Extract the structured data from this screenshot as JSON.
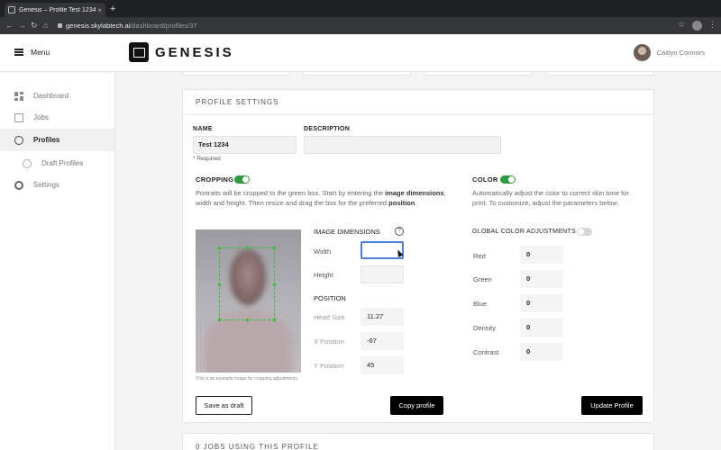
{
  "browser": {
    "tab_title": "Genesis – Profile Test 1234",
    "tab_close": "×",
    "new_tab": "+",
    "url_host": "genesis.skylabtech.ai",
    "url_path": "/dashboard/profiles/37"
  },
  "header": {
    "menu_label": "Menu",
    "brand": "GENESIS",
    "user_name": "Caitlyn Connors"
  },
  "sidebar": {
    "items": [
      {
        "label": "Dashboard",
        "icon": "dashboard-icon"
      },
      {
        "label": "Jobs",
        "icon": "jobs-icon"
      },
      {
        "label": "Profiles",
        "icon": "profiles-icon",
        "active": true
      },
      {
        "label": "Draft Profiles",
        "icon": "draft-profiles-icon"
      },
      {
        "label": "Settings",
        "icon": "gear-icon"
      }
    ]
  },
  "profile_settings": {
    "title": "PROFILE SETTINGS",
    "name_label": "NAME",
    "name_value": "Test 1234",
    "required_note": "* Required",
    "description_label": "DESCRIPTION",
    "description_value": ""
  },
  "cropping": {
    "title": "CROPPING",
    "enabled": true,
    "desc_1": "Portraits will be cropped to the green box. Start by entering the ",
    "desc_bold_1": "image dimensions",
    "desc_2": ", width and height. Then resize and drag the box for the preferred ",
    "desc_bold_2": "position",
    "desc_3": ".",
    "image_caption": "This is an example image for cropping adjustments.",
    "dimensions_title": "IMAGE DIMENSIONS",
    "help_glyph": "?",
    "width_label": "Width",
    "width_value": "",
    "height_label": "Height",
    "height_value": "",
    "position_title": "POSITION",
    "head_size_label": "Head Size",
    "head_size_value": "11.27",
    "x_position_label": "X Position",
    "x_position_value": "-67",
    "y_position_label": "Y Position",
    "y_position_value": "45"
  },
  "color": {
    "title": "COLOR",
    "enabled": true,
    "description": "Automatically adjust the color to correct skin tone for print. To customize, adjust the parameters below.",
    "global_label": "GLOBAL COLOR ADJUSTMENTS",
    "global_enabled": false,
    "params": [
      {
        "label": "Red",
        "value": "0"
      },
      {
        "label": "Green",
        "value": "0"
      },
      {
        "label": "Blue",
        "value": "0"
      },
      {
        "label": "Density",
        "value": "0"
      },
      {
        "label": "Contrast",
        "value": "0"
      }
    ]
  },
  "actions": {
    "save_draft": "Save as draft",
    "copy_profile": "Copy profile",
    "update_profile": "Update Profile"
  },
  "jobs_section": {
    "title": "0 JOBS USING THIS PROFILE"
  }
}
